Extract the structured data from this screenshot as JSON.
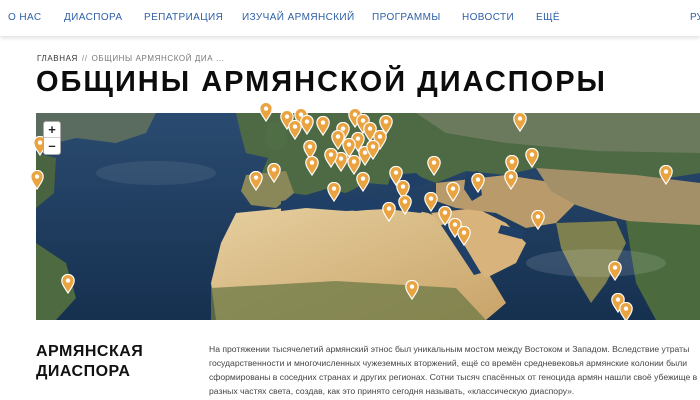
{
  "nav": {
    "items": [
      "О НАС",
      "ДИАСПОРА",
      "РЕПАТРИАЦИЯ",
      "ИЗУЧАЙ АРМЯНСКИЙ",
      "ПРОГРАММЫ",
      "НОВОСТИ",
      "ЕЩЁ"
    ],
    "lang": "РУ"
  },
  "breadcrumb": {
    "home": "ГЛАВНАЯ",
    "separator": "//",
    "current": "ОБЩИНЫ АРМЯНСКОЙ ДИА ..."
  },
  "page": {
    "title": "ОБЩИНЫ АРМЯНСКОЙ ДИАСПОРЫ"
  },
  "map": {
    "zoom_in": "+",
    "zoom_out": "–",
    "pin_color": "#e9a340",
    "pin_icon": "map-marker-icon"
  },
  "section": {
    "title_line1": "АРМЯНСКАЯ",
    "title_line2": "ДИАСПОРА",
    "text": "На протяжении тысячелетий армянский этнос был уникальным мостом между Востоком и Западом. Вследствие утраты государственности и многочисленных чужеземных вторжений, ещё со времён средневековья армянские колонии были сформированы в соседних странах и других регионах. Сотни тысяч спасённых от геноцида армян нашли своё убежище в разных частях света, создав, как это принято сегодня называть, «классическую диаспору»."
  }
}
